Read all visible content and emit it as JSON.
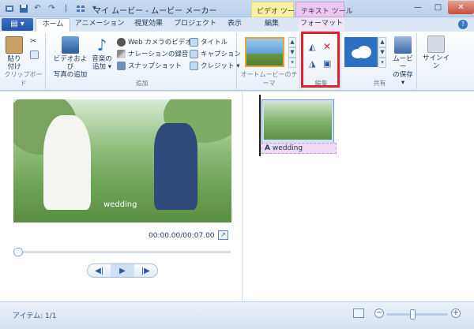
{
  "window": {
    "title": "マイ ムービー - ムービー メーカー",
    "minimize_icon": "minimize-icon",
    "maximize_icon": "maximize-icon",
    "close_icon": "close-icon"
  },
  "context_tabs": {
    "video_tools": "ビデオ ツール",
    "text_tools": "テキスト ツール"
  },
  "tabs": [
    {
      "label": "ホーム",
      "active": true
    },
    {
      "label": "アニメーション",
      "active": false
    },
    {
      "label": "視覚効果",
      "active": false
    },
    {
      "label": "プロジェクト",
      "active": false
    },
    {
      "label": "表示",
      "active": false
    },
    {
      "label": "編集",
      "active": false
    },
    {
      "label": "フォーマット",
      "active": false
    }
  ],
  "file_menu_icon": "file-menu-icon",
  "help_label": "?",
  "ribbon": {
    "clipboard": {
      "paste": "貼り\n付け",
      "cut_icon": "cut-icon",
      "copy_icon": "copy-icon",
      "group_label": "クリップボード"
    },
    "add": {
      "add_video_photo": "ビデオおよび\n写真の追加",
      "add_music": "音楽の\n追加 ▾",
      "webcam": "Web カメラのビデオ",
      "narration": "ナレーションの録音 ▾",
      "snapshot": "スナップショット",
      "title": "タイトル",
      "caption": "キャプション",
      "credits": "クレジット ▾",
      "group_label": "追加"
    },
    "automovie": {
      "group_label": "オートムービーのテーマ"
    },
    "edit": {
      "group_label": "編集"
    },
    "share": {
      "save_movie": "ムービー\nの保存 ▾",
      "group_label": "共有"
    },
    "signin": "サインイン"
  },
  "preview": {
    "caption": "wedding",
    "time": "00:00.00/00:07.00"
  },
  "storyboard": {
    "clip_caption": "wedding"
  },
  "status": {
    "items": "アイテム: 1/1"
  },
  "colors": {
    "accent": "#2d5a9a",
    "highlight": "#e0202a",
    "video_tools": "#f6f0a8",
    "text_tools": "#e7c9ee"
  }
}
